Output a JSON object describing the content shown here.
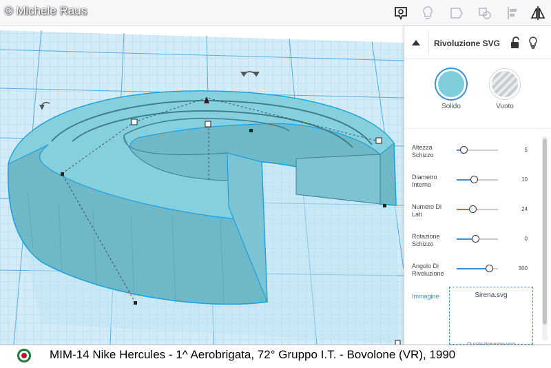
{
  "watermark": "© Michele Raus",
  "toolbar": {
    "icons": [
      "notes-icon",
      "lightbulb-icon",
      "group-icon",
      "ungroup-icon",
      "align-icon",
      "mirror-icon"
    ]
  },
  "panel": {
    "title": "Rivoluzione SVG",
    "solid_label": "Solido",
    "hole_label": "Vuoto",
    "solid_color": "#7fcedb",
    "accent_color": "#3b8fd6",
    "properties": [
      {
        "label_line1": "Altezza",
        "label_line2": "Schizzo",
        "value": "5",
        "slider_fraction": 0.17
      },
      {
        "label_line1": "Diametro",
        "label_line2": "Interno",
        "value": "10",
        "slider_fraction": 0.42
      },
      {
        "label_line1": "Numero Di",
        "label_line2": "Lati",
        "value": "24",
        "slider_fraction": 0.38
      },
      {
        "label_line1": "Rotazione",
        "label_line2": "Schizzo",
        "value": "0",
        "slider_fraction": 0.45
      },
      {
        "label_line1": "Angolo Di",
        "label_line2": "Rivoluzione",
        "value": "300",
        "slider_fraction": 0.78
      }
    ],
    "image_label": "Immagine",
    "image_file": "Sirena.svg",
    "image_hint": "O selezionarne uno"
  },
  "caption": {
    "text": "MIM-14 Nike Hercules - 1^ Aerobrigata, 72° Gruppo I.T. - Bovolone (VR), 1990"
  }
}
